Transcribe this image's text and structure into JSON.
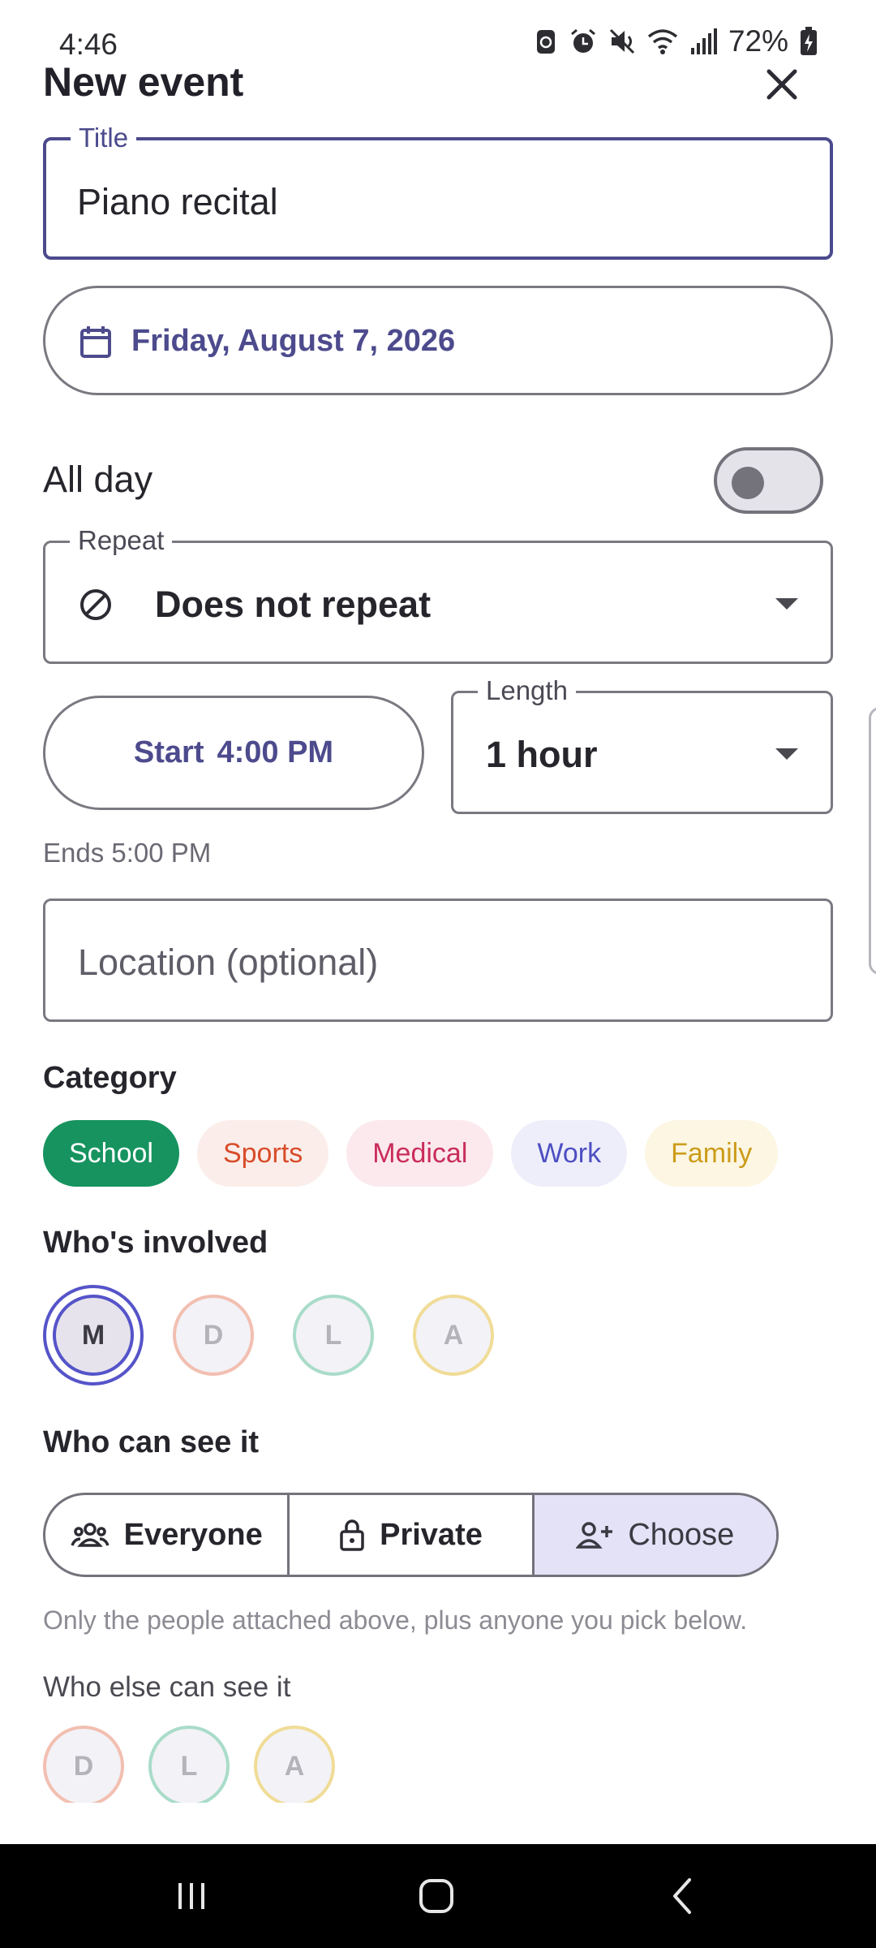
{
  "status_bar": {
    "time": "4:46",
    "battery": "72%"
  },
  "header": {
    "title": "New event"
  },
  "title_field": {
    "label": "Title",
    "value": "Piano recital"
  },
  "date": {
    "value": "Friday, August 7, 2026"
  },
  "all_day": {
    "label": "All day",
    "enabled": false
  },
  "repeat": {
    "label": "Repeat",
    "value": "Does not repeat"
  },
  "start": {
    "label": "Start",
    "time": "4:00 PM"
  },
  "length": {
    "label": "Length",
    "value": "1 hour"
  },
  "ends": {
    "text": "Ends 5:00 PM"
  },
  "location": {
    "placeholder": "Location (optional)"
  },
  "category": {
    "label": "Category",
    "selected": "School",
    "items": [
      "School",
      "Sports",
      "Medical",
      "Work",
      "Family"
    ],
    "colors": {
      "School": "#16935f",
      "Sports": "#d84c2a",
      "Medical": "#c92d5b",
      "Work": "#4d4fc1",
      "Family": "#cc9c1a"
    }
  },
  "involved": {
    "label": "Who's involved",
    "people": [
      "M",
      "D",
      "L",
      "A"
    ],
    "selected": "M"
  },
  "visibility": {
    "label": "Who can see it",
    "options": [
      "Everyone",
      "Private",
      "Choose"
    ],
    "selected": "Choose",
    "hint": "Only the people attached above, plus anyone you pick below."
  },
  "who_else": {
    "label": "Who else can see it",
    "people": [
      "D",
      "L",
      "A"
    ]
  },
  "accent_color": "#4d4b8d"
}
